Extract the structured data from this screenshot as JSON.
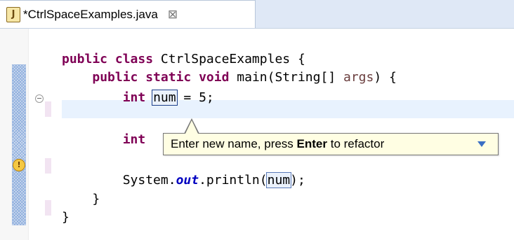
{
  "tab": {
    "icon_glyph": "J",
    "icon_name": "java-file-icon",
    "label": "*CtrlSpaceExamples.java",
    "close_glyph": "⊠"
  },
  "editor": {
    "lines": [
      {
        "kw1": "public class",
        "text": " CtrlSpaceExamples {"
      },
      {
        "indent": "    ",
        "kw1": "public static void",
        "text1": " main(String[] ",
        "param": "args",
        "text2": ") {"
      },
      {
        "indent": "        ",
        "kw1": "int",
        "sp": " ",
        "linked": "num",
        "text": " = 5;"
      },
      {
        "indent": "        ",
        "kw1": "int"
      },
      {
        "indent": "        ",
        "text1": "System.",
        "ital": "out",
        "text2": ".println(",
        "linked": "num",
        "text3": ");"
      },
      {
        "indent": "    ",
        "text": "}"
      },
      {
        "text": "}"
      }
    ],
    "warning_glyph": "!",
    "accent_keyword": "#7f0055",
    "accent_static_field": "#0000c0",
    "current_line_bg": "#e8f2fe"
  },
  "tooltip": {
    "text_before": "Enter new name, press ",
    "text_bold": "Enter",
    "text_after": " to refactor"
  }
}
